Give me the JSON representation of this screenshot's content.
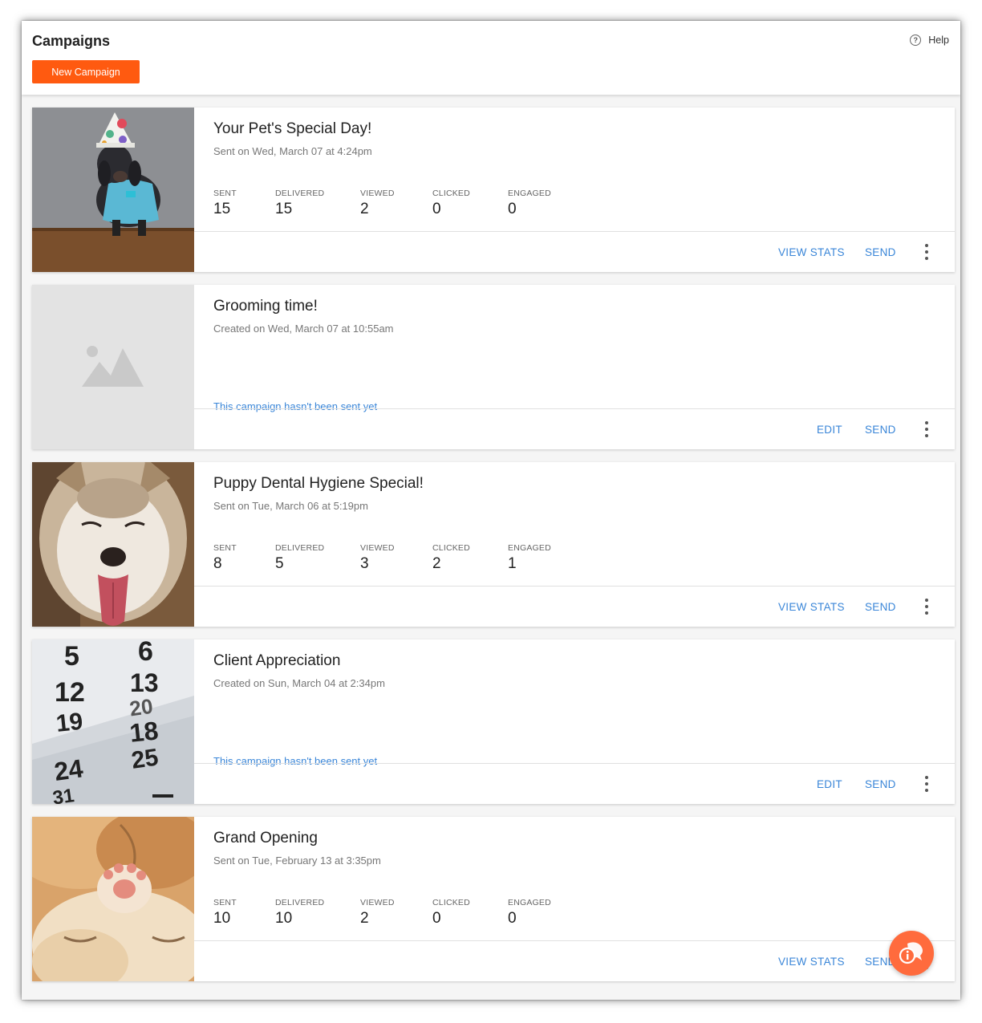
{
  "header": {
    "title": "Campaigns",
    "new_campaign_label": "New Campaign",
    "help_label": "Help",
    "help_icon": "?"
  },
  "stat_labels": {
    "sent": "SENT",
    "delivered": "DELIVERED",
    "viewed": "VIEWED",
    "clicked": "CLICKED",
    "engaged": "ENGAGED"
  },
  "actions": {
    "view_stats": "VIEW STATS",
    "send": "SEND",
    "edit": "EDIT"
  },
  "campaigns": [
    {
      "title": "Your Pet's Special Day!",
      "date": "Sent on Wed, March 07 at 4:24pm",
      "thumbnail": "party-dog-photo",
      "stats": {
        "sent": "15",
        "delivered": "15",
        "viewed": "2",
        "clicked": "0",
        "engaged": "0"
      }
    },
    {
      "title": "Grooming time!",
      "date": "Created on Wed, March 07 at 10:55am",
      "thumbnail": "image-placeholder-icon",
      "status": "This campaign hasn't been sent yet"
    },
    {
      "title": "Puppy Dental Hygiene Special!",
      "date": "Sent on Tue, March 06 at 5:19pm",
      "thumbnail": "husky-puppy-photo",
      "stats": {
        "sent": "8",
        "delivered": "5",
        "viewed": "3",
        "clicked": "2",
        "engaged": "1"
      }
    },
    {
      "title": "Client Appreciation",
      "date": "Created on Sun, March 04 at 2:34pm",
      "thumbnail": "calendar-photo",
      "calendar_numbers": [
        "5",
        "6",
        "12",
        "13",
        "19",
        "20",
        "18",
        "24",
        "25",
        "31"
      ],
      "status": "This campaign hasn't been sent yet"
    },
    {
      "title": "Grand Opening",
      "date": "Sent on Tue, February 13 at 3:35pm",
      "thumbnail": "kitten-and-puppy-photo",
      "stats": {
        "sent": "10",
        "delivered": "10",
        "viewed": "2",
        "clicked": "0",
        "engaged": "0"
      }
    }
  ],
  "chat_widget": {
    "icon": "chat-bubble-icon",
    "color": "#ff6b3d"
  },
  "colors": {
    "accent": "#ff5a10",
    "link": "#3a86d8"
  }
}
